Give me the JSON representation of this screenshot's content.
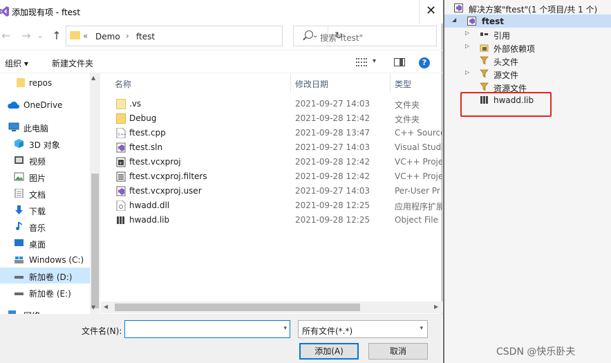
{
  "dialog": {
    "title": "添加现有项 - ftest",
    "close_glyph": "✕"
  },
  "navigation": {
    "back_glyph": "←",
    "forward_glyph": "→",
    "recent_glyph": "⌄",
    "up_glyph": "↑",
    "breadcrumb_prefix": "«",
    "breadcrumb": [
      "Demo",
      "ftest"
    ],
    "breadcrumb_separator": "›",
    "address_dropdown_glyph": "⌄",
    "refresh_glyph": "↻",
    "search_placeholder": "搜索\"ftest\""
  },
  "toolbar": {
    "organize_label": "组织 ▾",
    "new_folder_label": "新建文件夹",
    "view_dropdown_glyph": "▾",
    "help_glyph": "?"
  },
  "nav_pane": {
    "items": [
      {
        "label": "repos",
        "icon": "folder-icon"
      },
      {
        "label": "OneDrive",
        "icon": "cloud-icon"
      },
      {
        "label": "此电脑",
        "icon": "computer-icon"
      },
      {
        "label": "3D 对象",
        "icon": "cube-icon"
      },
      {
        "label": "视频",
        "icon": "video-icon"
      },
      {
        "label": "图片",
        "icon": "picture-icon"
      },
      {
        "label": "文档",
        "icon": "document-icon"
      },
      {
        "label": "下载",
        "icon": "download-icon"
      },
      {
        "label": "音乐",
        "icon": "music-icon"
      },
      {
        "label": "桌面",
        "icon": "desktop-icon"
      },
      {
        "label": "Windows (C:)",
        "icon": "drive-icon"
      },
      {
        "label": "新加卷 (D:)",
        "icon": "drive-icon"
      },
      {
        "label": "新加卷 (E:)",
        "icon": "drive-icon"
      },
      {
        "label": "网络",
        "icon": "network-icon"
      }
    ],
    "selected": "新加卷 (D:)",
    "scroll_up_glyph": "▲",
    "scroll_down_glyph": "▼"
  },
  "file_list": {
    "columns": {
      "name": "名称",
      "date": "修改日期",
      "type": "类型"
    },
    "sort_glyph": "^",
    "rows": [
      {
        "name": ".vs",
        "date": "2021-09-27 14:03",
        "type": "文件夹",
        "icon": "folder-icon"
      },
      {
        "name": "Debug",
        "date": "2021-09-28 12:42",
        "type": "文件夹",
        "icon": "folder-icon"
      },
      {
        "name": "ftest.cpp",
        "date": "2021-09-28 13:47",
        "type": "C++ Source",
        "icon": "cpp-file-icon"
      },
      {
        "name": "ftest.sln",
        "date": "2021-09-27 14:03",
        "type": "Visual Studio",
        "icon": "solution-file-icon"
      },
      {
        "name": "ftest.vcxproj",
        "date": "2021-09-28 12:42",
        "type": "VC++ Proje",
        "icon": "project-file-icon"
      },
      {
        "name": "ftest.vcxproj.filters",
        "date": "2021-09-28 12:42",
        "type": "VC++ Proje",
        "icon": "filters-file-icon"
      },
      {
        "name": "ftest.vcxproj.user",
        "date": "2021-09-27 14:03",
        "type": "Per-User Pr",
        "icon": "user-file-icon"
      },
      {
        "name": "hwadd.dll",
        "date": "2021-09-28 12:25",
        "type": "应用程序扩展",
        "icon": "dll-file-icon"
      },
      {
        "name": "hwadd.lib",
        "date": "2021-09-28 12:25",
        "type": "Object File",
        "icon": "lib-file-icon"
      }
    ],
    "scroll_left_glyph": "◀",
    "scroll_right_glyph": "▶"
  },
  "bottom": {
    "file_name_label": "文件名(N):",
    "file_name_value": "",
    "dropdown_glyph": "▾",
    "file_type_value": "所有文件(*.*)",
    "add_button": "添加(A)",
    "cancel_button": "取消"
  },
  "solution_explorer": {
    "solution_label": "解决方案\"ftest\"(1 个项目/共 1 个)",
    "project_label": "ftest",
    "nodes": [
      {
        "label": "引用",
        "expandable": true,
        "icon": "references-icon"
      },
      {
        "label": "外部依赖项",
        "expandable": true,
        "icon": "external-deps-icon"
      },
      {
        "label": "头文件",
        "expandable": false,
        "icon": "filter-folder-icon"
      },
      {
        "label": "源文件",
        "expandable": true,
        "icon": "filter-folder-icon"
      },
      {
        "label": "资源文件",
        "expandable": false,
        "icon": "filter-folder-icon"
      },
      {
        "label": "hwadd.lib",
        "expandable": false,
        "icon": "lib-file-icon"
      }
    ],
    "expand_glyph": "▷",
    "collapse_glyph": "◢"
  },
  "highlight_color": "#e3261d",
  "watermark": "CSDN @快乐卧夫"
}
